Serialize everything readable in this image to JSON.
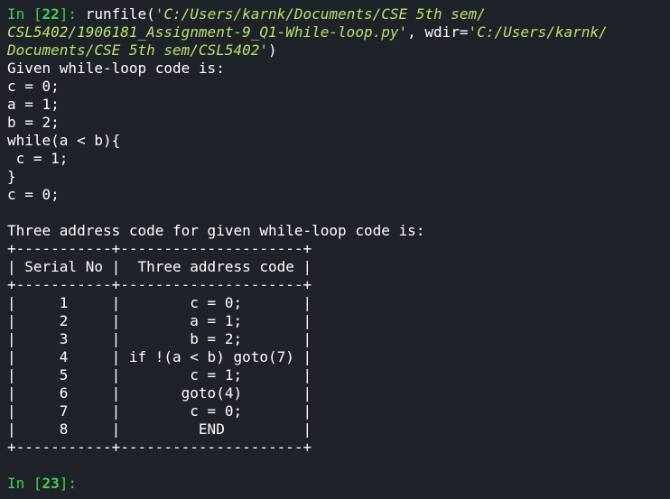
{
  "input_22": {
    "prompt_prefix": "In [",
    "prompt_number": "22",
    "prompt_suffix": "]: ",
    "call_open": "runfile(",
    "path_line1": "'C:/Users/karnk/Documents/CSE 5th sem/",
    "path_line2": "CSL5402/1906181_Assignment-9_Q1-While-loop.py'",
    "wdir_label": ", wdir=",
    "wdir_line2": "'C:/Users/karnk/",
    "wdir_line3": "Documents/CSE 5th sem/CSL5402'",
    "call_close": ")"
  },
  "output": {
    "heading1": "Given while-loop code is:",
    "code_lines": [
      "c = 0;",
      "a = 1;",
      "b = 2;",
      "while(a < b){",
      " c = 1;",
      "}",
      "c = 0;"
    ],
    "blank": "",
    "heading2": "Three address code for given while-loop code is:",
    "table_border": "+-----------+---------------------+",
    "table_header": "| Serial No |  Three address code |",
    "table_rows": [
      "|     1     |        c = 0;       |",
      "|     2     |        a = 1;       |",
      "|     3     |        b = 2;       |",
      "|     4     | if !(a < b) goto(7) |",
      "|     5     |        c = 1;       |",
      "|     6     |       goto(4)       |",
      "|     7     |        c = 0;       |",
      "|     8     |         END         |"
    ]
  },
  "input_23": {
    "prompt_prefix": "In [",
    "prompt_number": "23",
    "prompt_suffix": "]: "
  }
}
